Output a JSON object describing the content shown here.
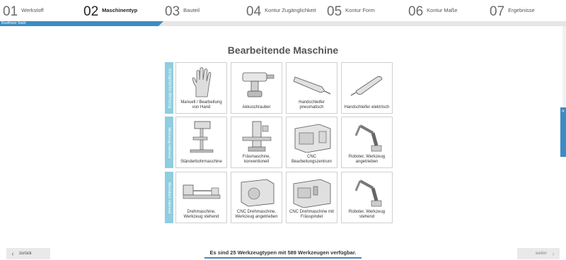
{
  "steps": [
    {
      "num": "01",
      "label": "Werkstoff"
    },
    {
      "num": "02",
      "label": "Maschinentyp"
    },
    {
      "num": "03",
      "label": "Bauteil"
    },
    {
      "num": "04",
      "label": "Kontur Zugänglichkeit"
    },
    {
      "num": "05",
      "label": "Kontur Form"
    },
    {
      "num": "06",
      "label": "Kontur Maße"
    },
    {
      "num": "07",
      "label": "Ergebnisse"
    }
  ],
  "active_step": "02",
  "progress_fraction": 0.28,
  "crumb": "Rostfreier Stahl",
  "title": "Bearbeitende Maschine",
  "rows": [
    {
      "label": "Handgeführtes Werkzeug",
      "tiles": [
        {
          "caption": "Manuell / Bearbeitung von Hand",
          "icon": "hand-glove-icon"
        },
        {
          "caption": "Akkuschrauber",
          "icon": "cordless-drill-icon"
        },
        {
          "caption": "Handschleifer pneumatisch",
          "icon": "pneumatic-grinder-icon"
        },
        {
          "caption": "Handschleifer elektrisch",
          "icon": "electric-grinder-icon"
        }
      ]
    },
    {
      "label": "Werkzeug rotierend",
      "tiles": [
        {
          "caption": "Ständerbohrmaschine",
          "icon": "drill-press-icon"
        },
        {
          "caption": "Fräsmaschine, konventionell",
          "icon": "milling-machine-icon"
        },
        {
          "caption": "CNC Bearbeitungszentrum",
          "icon": "cnc-center-icon"
        },
        {
          "caption": "Roboter, Werkzeug angetrieben",
          "icon": "robot-arm-icon"
        }
      ]
    },
    {
      "label": "Werkstück rotierend",
      "tiles": [
        {
          "caption": "Drehmaschine, Werkzeug stehend",
          "icon": "lathe-icon"
        },
        {
          "caption": "CNC Drehmaschine, Werkzeug angetrieben",
          "icon": "cnc-lathe-icon"
        },
        {
          "caption": "CNC Drehmaschine mit Frässpindel",
          "icon": "cnc-lathe-spindle-icon"
        },
        {
          "caption": "Roboter, Werkzeug stehend",
          "icon": "robot-arm-icon"
        }
      ]
    }
  ],
  "side_tab_icon": "double-chevron-left-icon",
  "footer": {
    "back_label": "zurück",
    "next_label": "weiter",
    "status": "Es sind 25 Werkzeugtypen mit 589 Werkzeugen verfügbar."
  },
  "colors": {
    "accent": "#3d8bc4",
    "row_label_bg": "#8fcde0"
  }
}
